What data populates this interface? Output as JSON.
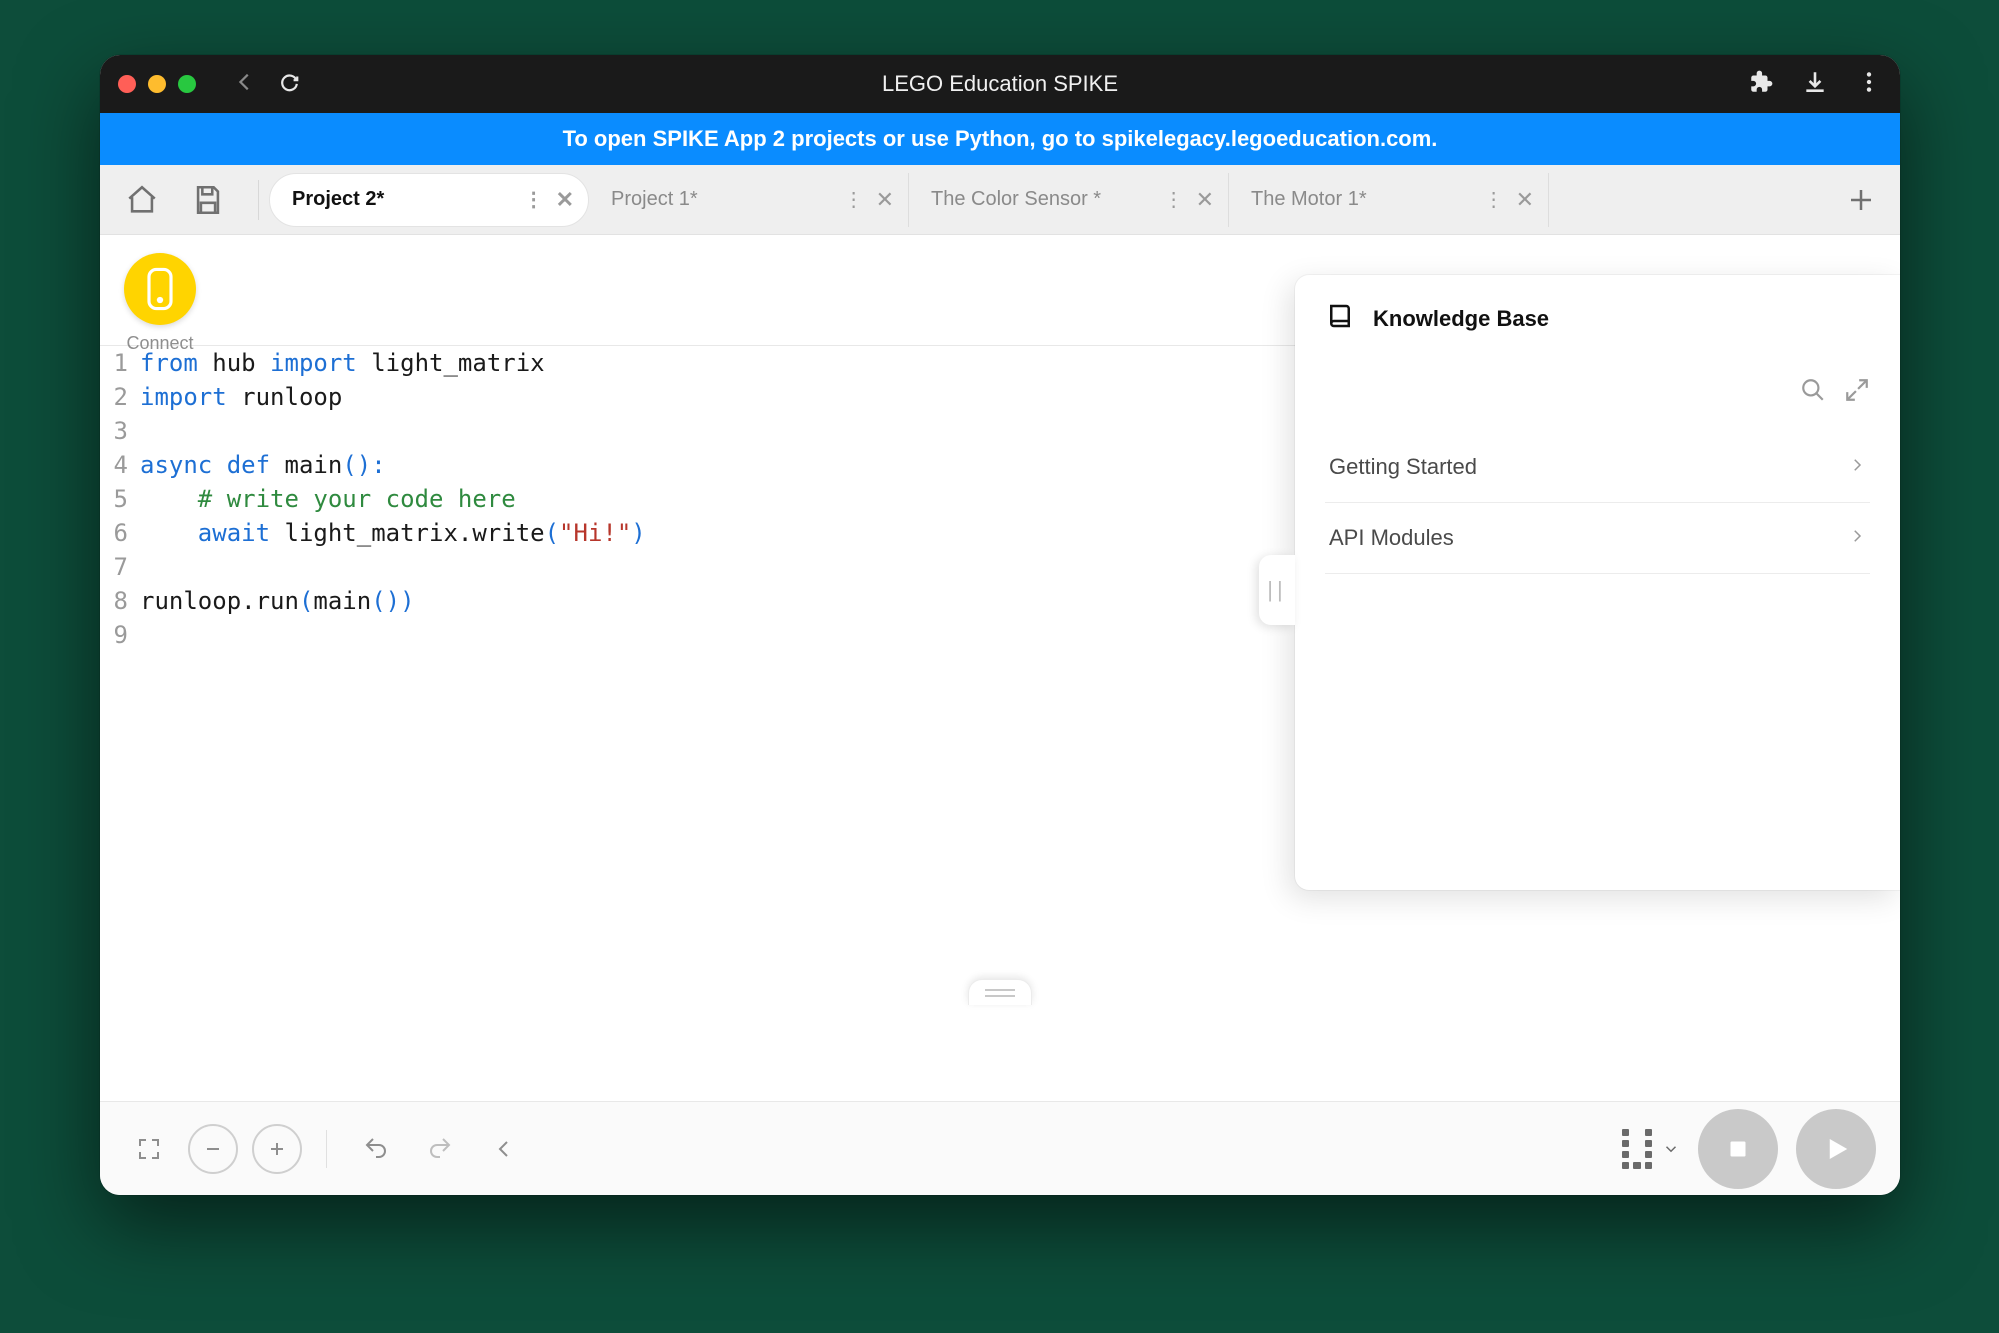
{
  "titlebar": {
    "title": "LEGO Education SPIKE"
  },
  "banner": {
    "text": "To open SPIKE App 2 projects or use Python, go to spikelegacy.legoeducation.com."
  },
  "tabs": [
    {
      "label": "Project 2*",
      "active": true
    },
    {
      "label": "Project 1*",
      "active": false
    },
    {
      "label": "The Color Sensor *",
      "active": false
    },
    {
      "label": "The Motor 1*",
      "active": false
    }
  ],
  "connect": {
    "label": "Connect"
  },
  "code": {
    "lines": [
      {
        "n": "1",
        "tokens": [
          [
            "kw",
            "from"
          ],
          [
            "sp",
            " "
          ],
          [
            "mod",
            "hub"
          ],
          [
            "sp",
            " "
          ],
          [
            "kw",
            "import"
          ],
          [
            "sp",
            " "
          ],
          [
            "mod",
            "light_matrix"
          ]
        ]
      },
      {
        "n": "2",
        "tokens": [
          [
            "kw",
            "import"
          ],
          [
            "sp",
            " "
          ],
          [
            "mod",
            "runloop"
          ]
        ]
      },
      {
        "n": "3",
        "tokens": []
      },
      {
        "n": "4",
        "tokens": [
          [
            "kw",
            "async"
          ],
          [
            "sp",
            " "
          ],
          [
            "kw",
            "def"
          ],
          [
            "sp",
            " "
          ],
          [
            "fn",
            "main"
          ],
          [
            "punc",
            "():"
          ]
        ]
      },
      {
        "n": "5",
        "tokens": [
          [
            "sp",
            "    "
          ],
          [
            "cmt",
            "# write your code here"
          ]
        ]
      },
      {
        "n": "6",
        "tokens": [
          [
            "sp",
            "    "
          ],
          [
            "kw",
            "await"
          ],
          [
            "sp",
            " "
          ],
          [
            "mod",
            "light_matrix.write"
          ],
          [
            "punc",
            "("
          ],
          [
            "str",
            "\"Hi!\""
          ],
          [
            "punc",
            ")"
          ]
        ]
      },
      {
        "n": "7",
        "tokens": []
      },
      {
        "n": "8",
        "tokens": [
          [
            "mod",
            "runloop.run"
          ],
          [
            "punc",
            "("
          ],
          [
            "mod",
            "main"
          ],
          [
            "punc",
            "())"
          ]
        ]
      },
      {
        "n": "9",
        "tokens": []
      }
    ]
  },
  "kb": {
    "title": "Knowledge Base",
    "items": [
      {
        "label": "Getting Started"
      },
      {
        "label": "API Modules"
      }
    ]
  }
}
